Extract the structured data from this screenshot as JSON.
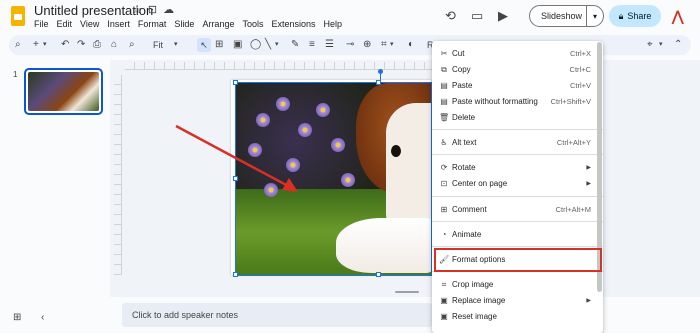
{
  "app": {
    "title": "Untitled presentation",
    "menu": [
      "File",
      "Edit",
      "View",
      "Insert",
      "Format",
      "Slide",
      "Arrange",
      "Tools",
      "Extensions",
      "Help"
    ]
  },
  "header": {
    "slideshow_label": "Slideshow",
    "share_label": "Share"
  },
  "toolbar": {
    "zoom_label": "Fit",
    "truncated_label": "Repl"
  },
  "filmstrip": {
    "slide_number": "1"
  },
  "notes": {
    "placeholder": "Click to add speaker notes"
  },
  "context_menu": {
    "items": [
      {
        "label": "Cut",
        "shortcut": "Ctrl+X",
        "icon": "scissors-icon"
      },
      {
        "label": "Copy",
        "shortcut": "Ctrl+C",
        "icon": "copy-icon"
      },
      {
        "label": "Paste",
        "shortcut": "Ctrl+V",
        "icon": "paste-icon"
      },
      {
        "label": "Paste without formatting",
        "shortcut": "Ctrl+Shift+V",
        "icon": "paste-plain-icon"
      },
      {
        "label": "Delete",
        "shortcut": "",
        "icon": "trash-icon"
      },
      {
        "label": "Alt text",
        "shortcut": "Ctrl+Alt+Y",
        "icon": "accessibility-icon"
      },
      {
        "label": "Rotate",
        "shortcut": "",
        "icon": "rotate-icon"
      },
      {
        "label": "Center on page",
        "shortcut": "",
        "icon": "center-icon"
      },
      {
        "label": "Comment",
        "shortcut": "Ctrl+Alt+M",
        "icon": "comment-icon"
      },
      {
        "label": "Animate",
        "shortcut": "",
        "icon": "animate-icon"
      },
      {
        "label": "Format options",
        "shortcut": "",
        "icon": "format-options-icon"
      },
      {
        "label": "Crop image",
        "shortcut": "",
        "icon": "crop-icon"
      },
      {
        "label": "Replace image",
        "shortcut": "",
        "icon": "replace-image-icon"
      },
      {
        "label": "Reset image",
        "shortcut": "",
        "icon": "reset-image-icon"
      }
    ]
  },
  "colors": {
    "accent": "#0b57d0",
    "highlight_border": "#d93025",
    "arrow": "#d93025",
    "share_bg": "#c2e7ff"
  }
}
